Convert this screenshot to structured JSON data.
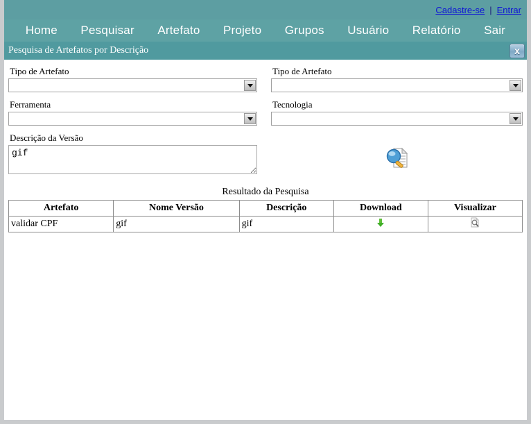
{
  "topbar": {
    "register_link": "Cadastre-se",
    "separator": "|",
    "login_link": "Entrar"
  },
  "nav": {
    "items": [
      {
        "label": "Home"
      },
      {
        "label": "Pesquisar"
      },
      {
        "label": "Artefato"
      },
      {
        "label": "Projeto"
      },
      {
        "label": "Grupos"
      },
      {
        "label": "Usuário"
      },
      {
        "label": "Relatório"
      },
      {
        "label": "Sair"
      }
    ]
  },
  "panel": {
    "title": "Pesquisa de Artefatos por Descrição",
    "close_icon": "close-icon"
  },
  "form": {
    "artifact_type_label": "Tipo de Artefato",
    "artifact_type_value": "",
    "artifact_type_right_label": "Tipo de Artefato",
    "artifact_type_right_value": "",
    "tool_label": "Ferramenta",
    "tool_value": "",
    "technology_label": "Tecnologia",
    "technology_value": "",
    "version_description_label": "Descrição da Versão",
    "version_description_value": "gif",
    "search_button_icon": "search-document-icon"
  },
  "results": {
    "caption": "Resultado da Pesquisa",
    "columns": [
      "Artefato",
      "Nome Versão",
      "Descrição",
      "Download",
      "Visualizar"
    ],
    "rows": [
      {
        "artefato": "validar CPF",
        "nome_versao": "gif",
        "descricao": "gif",
        "download_icon": "download-arrow-icon",
        "visualizar_icon": "magnifier-document-icon"
      }
    ]
  },
  "colors": {
    "topbar": "#5d9ea2",
    "navbar": "#5ea2a4",
    "panel_title": "#509a9f",
    "link": "#0e12d6",
    "download_arrow": "#52c234",
    "page_border": "#c9cbcd"
  }
}
